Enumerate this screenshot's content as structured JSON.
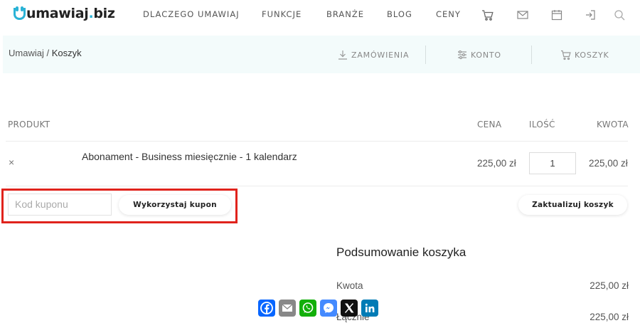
{
  "header": {
    "logo_text_main": "umawiaj",
    "logo_text_dot": ".",
    "logo_text_tld": "biz",
    "nav": [
      "DLACZEGO UMAWIAJ",
      "FUNKCJE",
      "BRANŻE",
      "BLOG",
      "CENY"
    ],
    "icons": [
      "cart-icon",
      "mail-icon",
      "calendar-icon",
      "login-icon",
      "search-icon"
    ]
  },
  "breadcrumb": {
    "root": "Umawiaj /",
    "current": "Koszyk"
  },
  "subnav": {
    "orders": "ZAMÓWIENIA",
    "account": "KONTO",
    "cart": "KOSZYK"
  },
  "cart": {
    "headers": {
      "product": "PRODUKT",
      "price": "CENA",
      "quantity": "ILOŚĆ",
      "amount": "KWOTA"
    },
    "items": [
      {
        "remove": "×",
        "name": "Abonament - Business miesięcznie - 1 kalendarz",
        "price": "225,00 zł",
        "quantity": "1",
        "amount": "225,00 zł"
      }
    ]
  },
  "coupon": {
    "placeholder": "Kod kuponu",
    "apply_label": "Wykorzystaj kupon",
    "update_label": "Zaktualizuj koszyk"
  },
  "summary": {
    "title": "Podsumowanie koszyka",
    "rows": [
      {
        "label": "Kwota",
        "value": "225,00 zł"
      },
      {
        "label": "Łącznie",
        "value": "225,00 zł"
      }
    ]
  },
  "share": [
    "facebook-icon",
    "email-icon",
    "whatsapp-icon",
    "messenger-icon",
    "x-icon",
    "linkedin-icon"
  ],
  "colors": {
    "brand": "#2bb3d6",
    "highlight": "#e0231c",
    "subbar_bg": "#f3fbfb"
  }
}
